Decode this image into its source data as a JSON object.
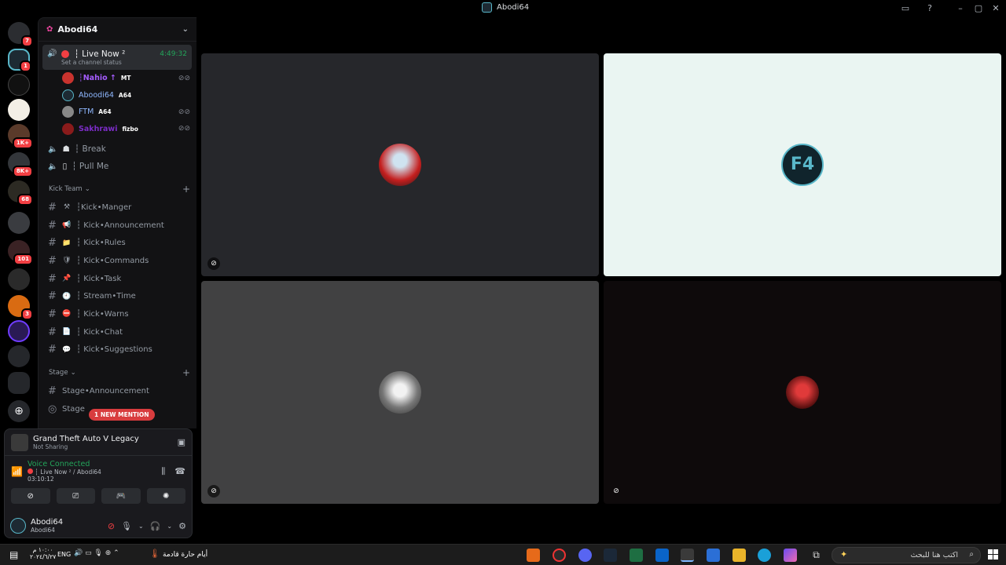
{
  "window": {
    "title": "Abodi64"
  },
  "server": {
    "name": "Abodi64"
  },
  "guild_badges": [
    "7",
    "1",
    "1K+",
    "8K+",
    "68",
    "101",
    "3"
  ],
  "live_channel": {
    "name": "┆ Live Now ²",
    "timer": "4:49:32",
    "status": "Set a channel status"
  },
  "members": [
    {
      "name": "┆Nahio ↑",
      "tag": "MT",
      "color": "#a55cff"
    },
    {
      "name": "Aboodi64",
      "tag": "A64",
      "color": "#8fb8ff"
    },
    {
      "name": "FTM",
      "tag": "A64",
      "color": "#8fb8ff"
    },
    {
      "name": "Sakhrawi",
      "tag": "fizbo",
      "color": "#7b2cc6"
    }
  ],
  "voice_channels": [
    {
      "icon": "☗",
      "name": "┆ Break"
    },
    {
      "icon": "▯",
      "name": "┆ Pull Me"
    }
  ],
  "kick_team": {
    "category": "Kick Team",
    "channels": [
      {
        "icon": "⚒",
        "name": "┆Kick•Manger"
      },
      {
        "icon": "📢",
        "name": "┆ Kick•Announcement"
      },
      {
        "icon": "📁",
        "name": "┆ Kick•Rules"
      },
      {
        "icon": "🛡",
        "name": "┆ Kick•Commands"
      },
      {
        "icon": "📌",
        "name": "┆ Kick•Task"
      },
      {
        "icon": "🕘",
        "name": "┆ Stream•Time"
      },
      {
        "icon": "⛔",
        "name": "┆ Kick•Warns"
      },
      {
        "icon": "📄",
        "name": "┆ Kick•Chat"
      },
      {
        "icon": "💬",
        "name": "┆ Kick•Suggestions"
      }
    ]
  },
  "stage_cat": {
    "category": "Stage",
    "channels": [
      {
        "name": "Stage•Announcement"
      },
      {
        "name": "Stage"
      }
    ]
  },
  "mention_pill": "1 NEW MENTION",
  "activity": {
    "game": "Grand Theft Auto V Legacy",
    "sub": "Not Sharing"
  },
  "voice": {
    "status": "Voice Connected",
    "channel": "┆ Live Now ² / Abodi64",
    "timer": "03:10:12"
  },
  "user": {
    "name": "Abodi64",
    "sub": "Abodi64"
  },
  "taskbar": {
    "lang": "ENG",
    "time": "١٠:٠٠ م",
    "date": "٢٠٢٤/٦/٢٧",
    "weather": "أيام حارة قادمة",
    "search_placeholder": "اكتب هنا للبحث"
  },
  "colors": {
    "accent_green": "#23a55a",
    "danger": "#f23f43",
    "bg": "#000000"
  }
}
